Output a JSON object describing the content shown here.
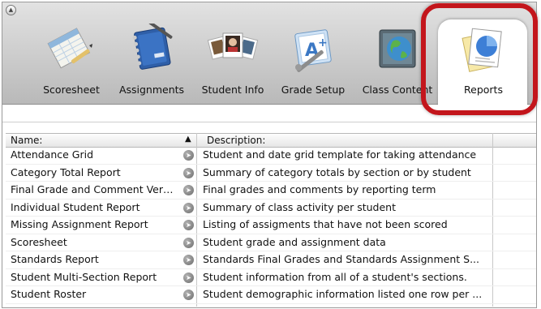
{
  "toolbar": {
    "items": [
      {
        "label": "Scoresheet",
        "icon": "scoresheet-icon"
      },
      {
        "label": "Assignments",
        "icon": "notebook-icon"
      },
      {
        "label": "Student Info",
        "icon": "student-photos-icon"
      },
      {
        "label": "Grade Setup",
        "icon": "grade-setup-icon"
      },
      {
        "label": "Class Content",
        "icon": "globe-icon"
      },
      {
        "label": "Reports",
        "icon": "pie-chart-report-icon"
      }
    ],
    "selected": "Reports",
    "highlight_color": "#c3161c"
  },
  "grid": {
    "columns": {
      "name": "Name:",
      "sort_indicator": "▲",
      "description": "Description:"
    },
    "rows": [
      {
        "name": "Attendance Grid",
        "description": "Student and date grid template for taking attendance"
      },
      {
        "name": "Category Total Report",
        "description": "Summary of category totals by section or by student"
      },
      {
        "name": "Final Grade and Comment Ver…",
        "description": "Final grades and comments by reporting term"
      },
      {
        "name": "Individual Student Report",
        "description": "Summary of class activity per student"
      },
      {
        "name": "Missing Assignment Report",
        "description": "Listing of assigments that have not been scored"
      },
      {
        "name": "Scoresheet",
        "description": "Student grade and assignment data"
      },
      {
        "name": "Standards Report",
        "description": "Standards Final Grades and Standards Assignment S..."
      },
      {
        "name": "Student Multi-Section Report",
        "description": "Student information from all of a student's sections."
      },
      {
        "name": "Student Roster",
        "description": "Student demographic information listed one row per ..."
      }
    ]
  }
}
